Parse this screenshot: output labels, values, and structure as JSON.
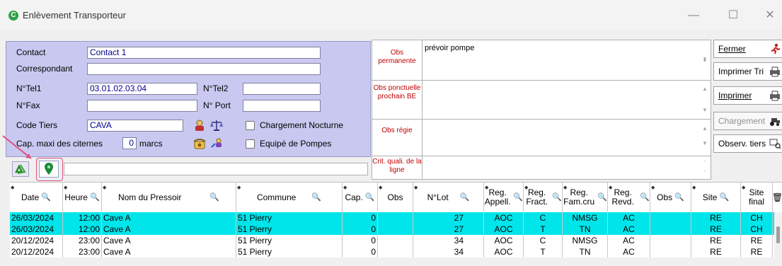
{
  "window": {
    "title": "Enlèvement Transporteur",
    "icon_letter": "C",
    "minimize": "—",
    "maximize": "☐",
    "close": "✕"
  },
  "form": {
    "contact_label": "Contact",
    "contact_value": "Contact 1",
    "correspondant_label": "Correspondant",
    "correspondant_value": "",
    "tel1_label": "N°Tel1",
    "tel1_value": "03.01.02.03.04",
    "tel2_label": "N°Tel2",
    "tel2_value": "",
    "fax_label": "N°Fax",
    "fax_value": "",
    "port_label": "N° Port",
    "port_value": "",
    "code_tiers_label": "Code Tiers",
    "code_tiers_value": "CAVA",
    "cap_label": "Cap. maxi des citernes",
    "cap_value": "0",
    "cap_unit": "marcs",
    "chargement_nocturne_label": "Chargement Nocturne",
    "equipe_pompes_label": "Equipé de Pompes"
  },
  "obs": {
    "permanente_label": "Obs permanente",
    "permanente_value": "prévoir pompe",
    "ponctuelle_label": "Obs ponctuelle prochain BE",
    "ponctuelle_value": "",
    "regie_label": "Obs régie",
    "regie_value": "",
    "crit_label": "Crit. quali. de la ligne",
    "crit_value": ""
  },
  "actions": {
    "fermer": "Fermer",
    "imprimer_tri": "Imprimer Tri",
    "imprimer": "Imprimer",
    "chargement": "Chargement",
    "observ_tiers": "Observ. tiers"
  },
  "grid": {
    "columns": [
      "Date",
      "Heure",
      "Nom du Pressoir",
      "Commune",
      "Cap.",
      "Obs",
      "N°Lot",
      "Reg. Appell.",
      "Reg. Fract.",
      "Reg. Fam.cru",
      "Reg. Revd.",
      "Obs",
      "Site",
      "Site final"
    ],
    "rows": [
      {
        "date": "26/03/2024",
        "heure": "12:00",
        "pressoir": "Cave A",
        "commune": "51 Pierry",
        "cap": "0",
        "obs": "",
        "lot": "27",
        "appell": "AOC",
        "fract": "C",
        "famcru": "NMSG",
        "revd": "AC",
        "obs2": "",
        "site": "RE",
        "site_final": "CH"
      },
      {
        "date": "26/03/2024",
        "heure": "12:00",
        "pressoir": "Cave A",
        "commune": "51 Pierry",
        "cap": "0",
        "obs": "",
        "lot": "27",
        "appell": "AOC",
        "fract": "T",
        "famcru": "TN",
        "revd": "AC",
        "obs2": "",
        "site": "RE",
        "site_final": "CH"
      },
      {
        "date": "20/12/2024",
        "heure": "23:00",
        "pressoir": "Cave A",
        "commune": "51 Pierry",
        "cap": "0",
        "obs": "",
        "lot": "34",
        "appell": "AOC",
        "fract": "C",
        "famcru": "NMSG",
        "revd": "AC",
        "obs2": "",
        "site": "RE",
        "site_final": "RE"
      },
      {
        "date": "20/12/2024",
        "heure": "23:00",
        "pressoir": "Cave A",
        "commune": "51 Pierry",
        "cap": "0",
        "obs": "",
        "lot": "34",
        "appell": "AOC",
        "fract": "T",
        "famcru": "TN",
        "revd": "AC",
        "obs2": "",
        "site": "RE",
        "site_final": "RE"
      }
    ]
  },
  "colors": {
    "selected_row": "#00e5ea",
    "form_bg": "#c8c8f0",
    "obs_label": "#c00000",
    "highlight_border": "#e05070"
  }
}
